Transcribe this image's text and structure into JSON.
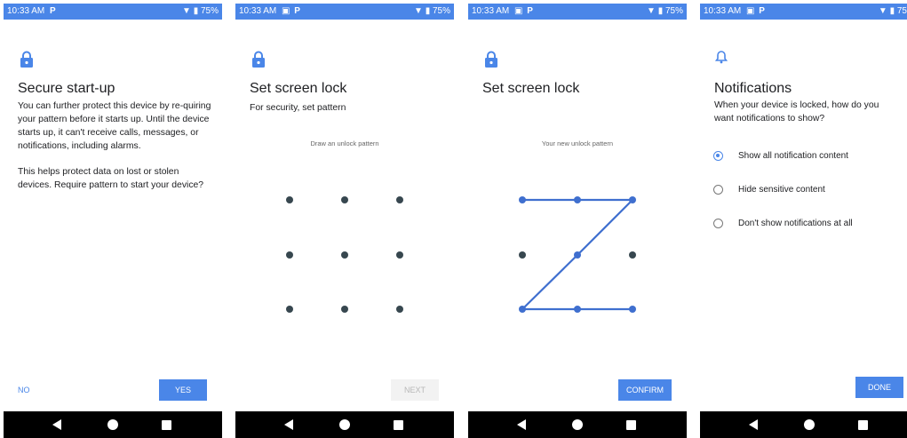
{
  "status": {
    "time": "10:33 AM",
    "screens_extra": [
      "P",
      "▣  P",
      "▣  P",
      "▣  P"
    ],
    "battery": [
      "75%",
      "75%",
      "75%",
      "75"
    ]
  },
  "secure_startup": {
    "title": "Secure start-up",
    "para1": "You can further protect this device by re-quiring your pattern before it starts up. Until the device starts up, it can't receive calls, messages, or notifications, including alarms.",
    "para2": "This helps protect data on lost or stolen devices. Require pattern to start your device?",
    "no_label": "NO",
    "yes_label": "YES"
  },
  "set_lock_1": {
    "title": "Set screen lock",
    "subtitle": "For security, set pattern",
    "hint": "Draw an unlock pattern",
    "next_label": "NEXT"
  },
  "set_lock_2": {
    "title": "Set screen lock",
    "hint": "Your new unlock pattern",
    "confirm_label": "CONFIRM"
  },
  "notifications": {
    "title": "Notifications",
    "description": "When your device is locked, how do you want notifications to show?",
    "options": [
      {
        "label": "Show all notification content",
        "selected": true
      },
      {
        "label": "Hide sensitive content",
        "selected": false
      },
      {
        "label": "Don't show notifications at all",
        "selected": false
      }
    ],
    "done_label": "DONE"
  },
  "colors": {
    "accent": "#4a86e8",
    "dot": "#37474f",
    "navbar": "#000000"
  }
}
